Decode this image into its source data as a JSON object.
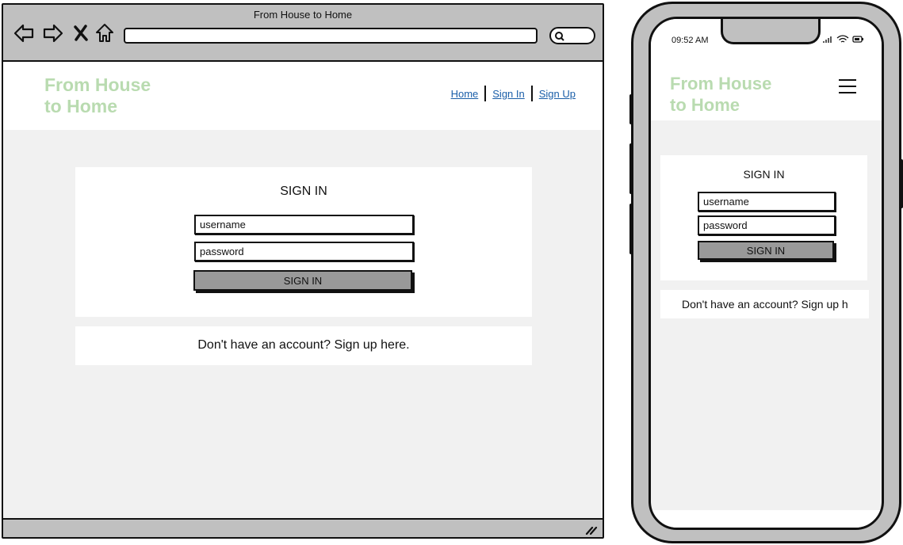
{
  "desktop": {
    "window_title": "From House to Home",
    "logo_line1": "From House",
    "logo_line2": "to Home",
    "nav": {
      "home": "Home",
      "sign_in": "Sign In",
      "sign_up": "Sign Up"
    },
    "form": {
      "title": "SIGN IN",
      "username_placeholder": "username",
      "password_placeholder": "password",
      "submit_label": "SIGN IN"
    },
    "signup_prompt": "Don't have an account? Sign up here."
  },
  "mobile": {
    "status_time": "09:52 AM",
    "logo_line1": "From House",
    "logo_line2": "to Home",
    "form": {
      "title": "SIGN IN",
      "username_placeholder": "username",
      "password_placeholder": "password",
      "submit_label": "SIGN IN"
    },
    "signup_prompt": "Don't have an account? Sign up h"
  },
  "colors": {
    "logo": "#b9dbb0",
    "link": "#1a5ea8",
    "chrome": "#c0c0c0",
    "page_bg": "#f1f1f1",
    "button": "#999999"
  },
  "icons": [
    "back-arrow-icon",
    "forward-arrow-icon",
    "close-icon",
    "home-icon",
    "search-icon",
    "resize-grip-icon",
    "signal-icon",
    "wifi-icon",
    "battery-icon",
    "hamburger-menu-icon"
  ]
}
